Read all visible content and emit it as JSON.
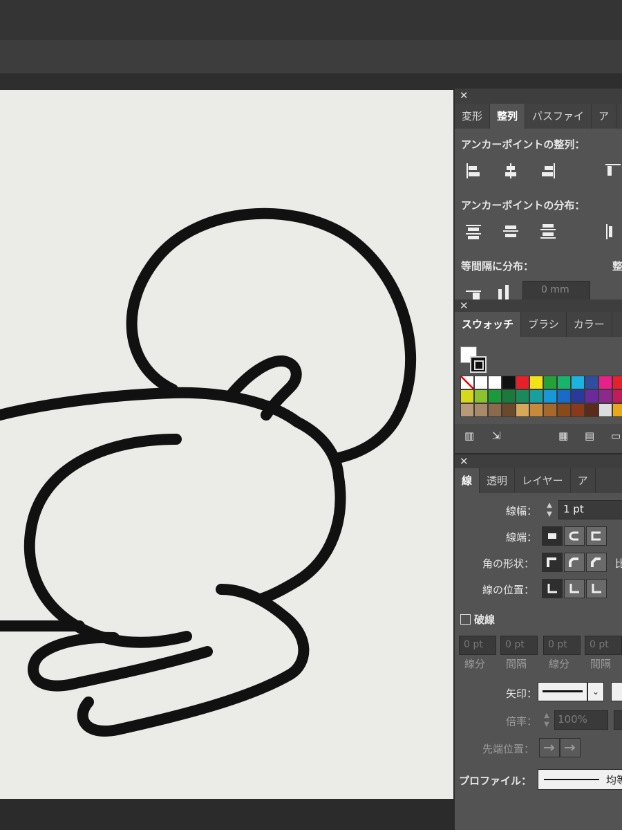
{
  "align_panel": {
    "tabs": [
      "変形",
      "整列",
      "パスファイ",
      "ア"
    ],
    "anchor_align_label": "アンカーポイントの整列：",
    "anchor_distribute_label": "アンカーポイントの分布：",
    "equal_spacing_label": "等間隔に分布：",
    "spacing_value": "0 mm",
    "align_to_label": "整"
  },
  "swatch_panel": {
    "tabs": [
      "スウォッチ",
      "ブラシ",
      "カラー"
    ],
    "swatches": [
      "none",
      "#ffffff",
      "#ffffff",
      "#111111",
      "#e8202a",
      "#f2e316",
      "#22a33a",
      "#18b46b",
      "#1ab3e2",
      "#2f4ea0",
      "#e8208a",
      "#e8202a",
      "#d8d81a",
      "#8ac232",
      "#1a9a3a",
      "#1a7a3a",
      "#1a8a5a",
      "#18a0a0",
      "#1898d8",
      "#1a6ac8",
      "#2a3a9a",
      "#6a2a9a",
      "#8a2a8a",
      "#c21a5a",
      "#b89a7a",
      "#a88a6a",
      "#8a6a4a",
      "#6a4a2a",
      "#d8a85a",
      "#c88a3a",
      "#a8682a",
      "#884a1a",
      "#8a3a1a",
      "#5a2a1a",
      "#dddddd",
      "#e8a818"
    ]
  },
  "stroke_panel": {
    "tabs": [
      "線",
      "透明",
      "レイヤー",
      "ア"
    ],
    "weight_label": "線幅：",
    "weight_value": "1 pt",
    "cap_label": "線端：",
    "corner_label": "角の形状：",
    "corner_extra": "比",
    "position_label": "線の位置：",
    "dashed_label": "破線",
    "dash_values": [
      "0 pt",
      "0 pt",
      "0 pt",
      "0 pt"
    ],
    "dash_labels": [
      "線分",
      "間隔",
      "線分",
      "間隔"
    ],
    "arrow_label": "矢印：",
    "scale_label": "倍率：",
    "scale_value": "100%",
    "tip_label": "先端位置：",
    "profile_label": "プロファイル：",
    "profile_value": "均等"
  }
}
